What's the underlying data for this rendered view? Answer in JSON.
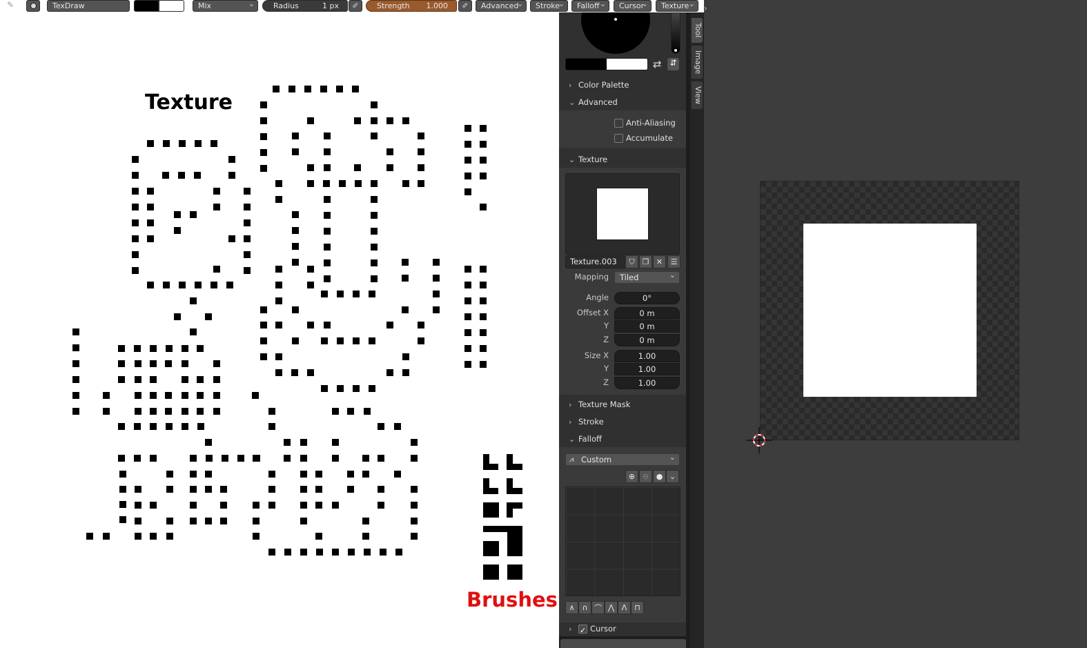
{
  "header": {
    "mode_name": "TexDraw",
    "blend_mode": "Mix",
    "radius_label": "Radius",
    "radius_value": "1 px",
    "strength_label": "Strength",
    "strength_value": "1.000",
    "menus": [
      "Advanced",
      "Stroke",
      "Falloff",
      "Cursor",
      "Texture"
    ]
  },
  "canvas_overlay": {
    "texture_title": "Texture",
    "brushes_title": "Brushes"
  },
  "sidebar_tabs": [
    "Tool",
    "Image",
    "View"
  ],
  "panel": {
    "sections": {
      "color_palette": "Color Palette",
      "advanced": "Advanced",
      "texture": "Texture",
      "texture_mask": "Texture Mask",
      "stroke": "Stroke",
      "falloff": "Falloff",
      "cursor": "Cursor"
    },
    "advanced_options": [
      {
        "label": "Anti-Aliasing",
        "checked": false
      },
      {
        "label": "Accumulate",
        "checked": false
      }
    ],
    "texture_name": "Texture.003",
    "mapping_label": "Mapping",
    "mapping_value": "Tiled",
    "angle_label": "Angle",
    "angle_value": "0°",
    "offset_x_label": "Offset X",
    "offset_x": "0 m",
    "offset_y_label": "Y",
    "offset_y": "0 m",
    "offset_z_label": "Z",
    "offset_z": "0 m",
    "size_x_label": "Size X",
    "size_x": "1.00",
    "size_y_label": "Y",
    "size_y": "1.00",
    "size_z_label": "Z",
    "size_z": "1.00",
    "falloff_preset": "Custom",
    "cursor_checked": true
  },
  "colors": {
    "panel_bg": "#303030",
    "strength_slider": "#9a5a2c",
    "brushes_title": "#e01010",
    "editor_bg": "#3d3d3d"
  }
}
